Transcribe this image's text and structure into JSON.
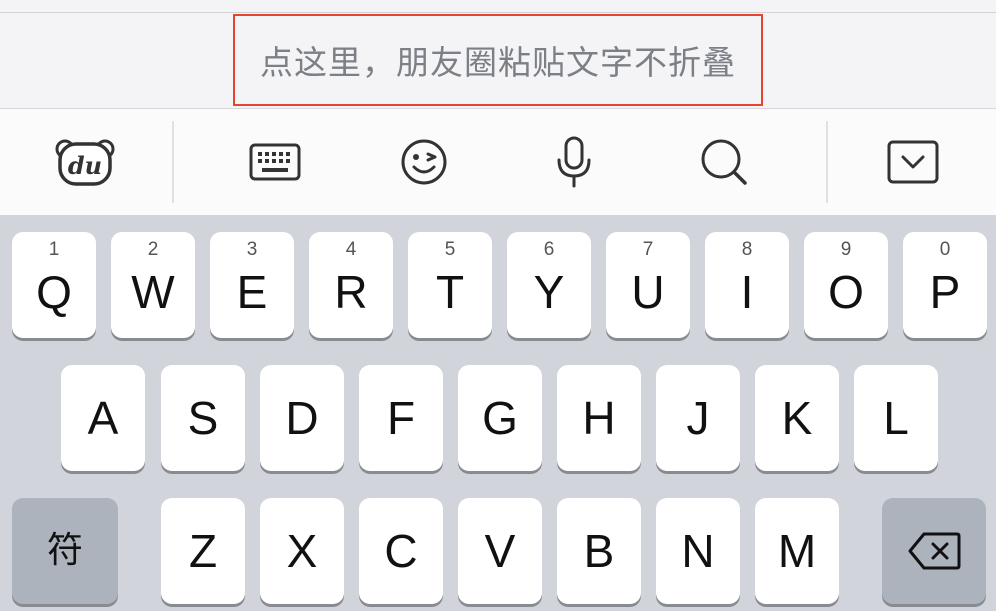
{
  "paste_hint": "点这里，朋友圈粘贴文字不折叠",
  "toolbar": {
    "icons": [
      "du-bear-logo-icon",
      "keyboard-icon",
      "emoji-wink-icon",
      "microphone-icon",
      "search-icon",
      "collapse-keyboard-icon"
    ]
  },
  "keyboard": {
    "row1": [
      {
        "letter": "Q",
        "num": "1"
      },
      {
        "letter": "W",
        "num": "2"
      },
      {
        "letter": "E",
        "num": "3"
      },
      {
        "letter": "R",
        "num": "4"
      },
      {
        "letter": "T",
        "num": "5"
      },
      {
        "letter": "Y",
        "num": "6"
      },
      {
        "letter": "U",
        "num": "7"
      },
      {
        "letter": "I",
        "num": "8"
      },
      {
        "letter": "O",
        "num": "9"
      },
      {
        "letter": "P",
        "num": "0"
      }
    ],
    "row2": [
      "A",
      "S",
      "D",
      "F",
      "G",
      "H",
      "J",
      "K",
      "L"
    ],
    "row3": [
      "Z",
      "X",
      "C",
      "V",
      "B",
      "N",
      "M"
    ],
    "symbol_key": "符",
    "delete_icon": "backspace-icon"
  },
  "colors": {
    "highlight_border": "#e6442f",
    "hint_text": "#7c7f86",
    "keyboard_bg": "#d1d4da",
    "function_key": "#adb3bd"
  }
}
